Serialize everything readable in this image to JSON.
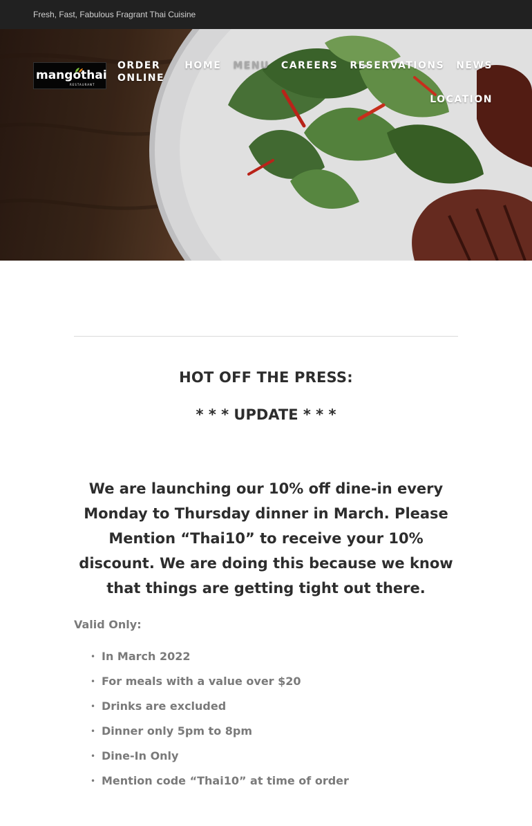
{
  "topbar": {
    "tagline": "Fresh, Fast, Fabulous Fragrant Thai Cuisine"
  },
  "logo": {
    "wordmark": "mangothai",
    "subtitle": "RESTAURANT"
  },
  "nav": {
    "row1": [
      "ORDER ONLINE",
      "HOME",
      "MENU",
      "CAREERS",
      "RESERVATIONS",
      "NEWS"
    ],
    "row2": [
      "LOCATION"
    ],
    "active": "MENU"
  },
  "post": {
    "heading": "HOT OFF THE PRESS:",
    "update": "* * * UPDATE * * *",
    "announcement": "We are launching our 10% off dine-in  every Monday to Thursday dinner in March. Please Mention “Thai10” to receive your 10% discount. We are doing this because we know that things are getting tight out there.",
    "valid_label": "Valid Only:",
    "conditions": [
      " In March 2022",
      "For meals with a value over $20",
      "Drinks are excluded",
      "Dinner only 5pm to 8pm",
      "Dine-In Only",
      "Mention code “Thai10” at time of order"
    ]
  },
  "colors": {
    "topbar_bg": "#212121",
    "nav_active": "#a8a8a8",
    "body_text": "#2d2d2d",
    "muted_text": "#7a7a7a"
  },
  "icons": {
    "bullet": "bullet-icon",
    "logo_leaf": "leaf-icon"
  }
}
